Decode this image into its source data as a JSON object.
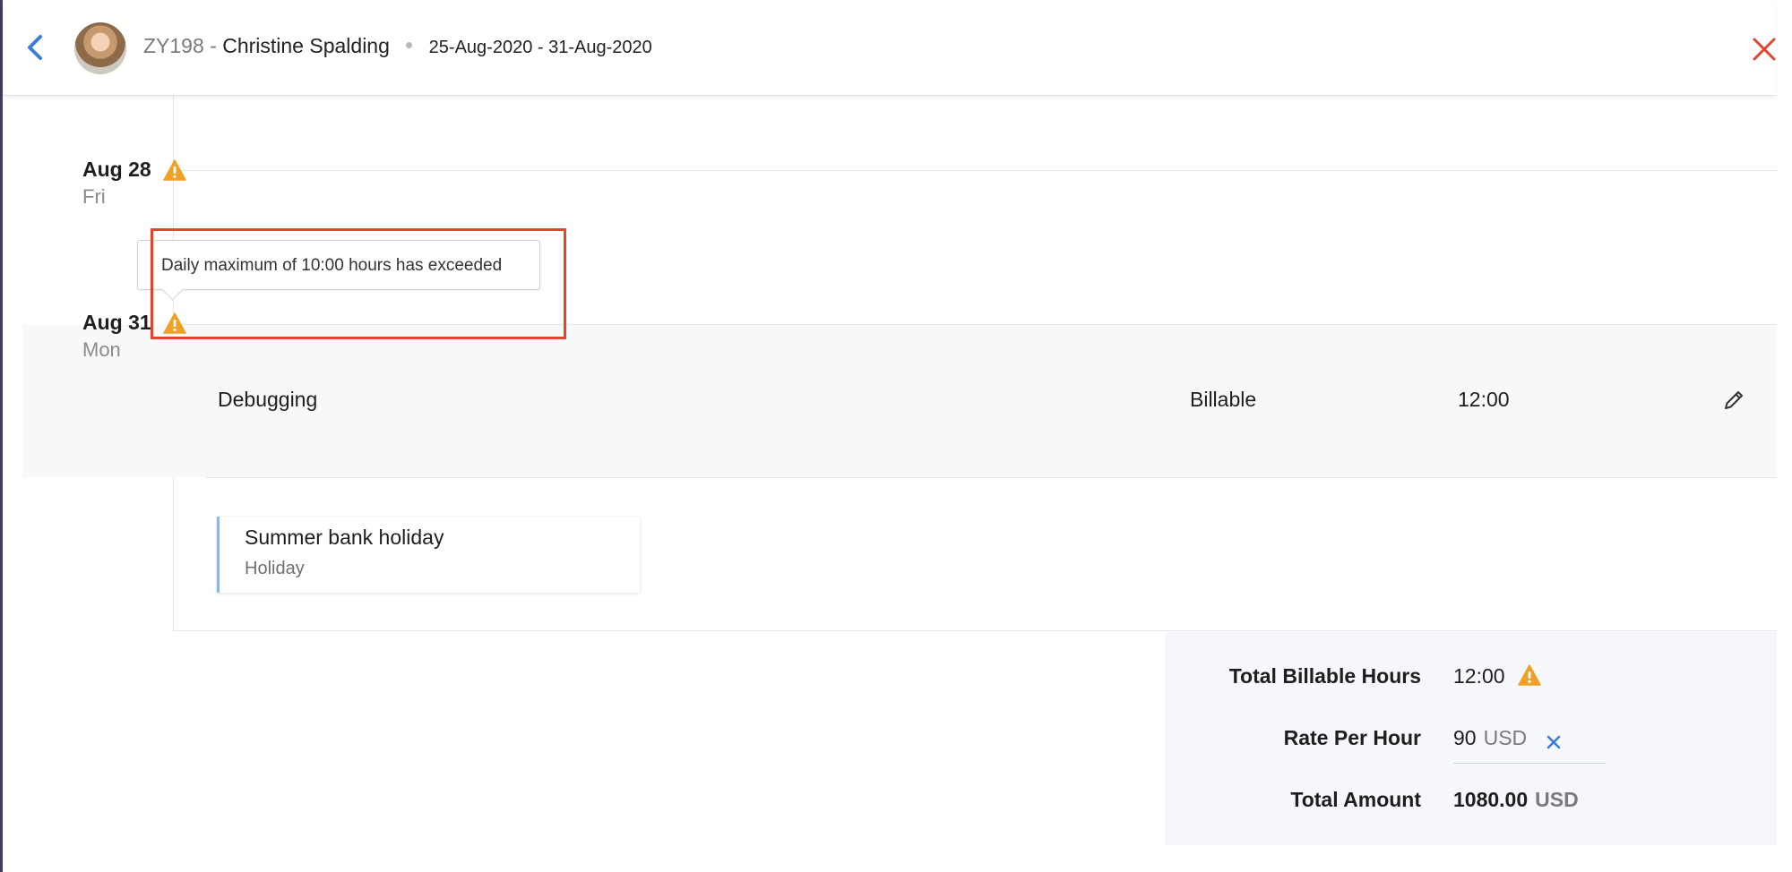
{
  "header": {
    "employee_code": "ZY198",
    "separator": "-",
    "employee_name": "Christine Spalding",
    "date_range": "25-Aug-2020 - 31-Aug-2020"
  },
  "days": [
    {
      "date": "Aug 28",
      "weekday": "Fri",
      "warning": true
    },
    {
      "date": "Aug 31",
      "weekday": "Mon",
      "warning": true
    }
  ],
  "tooltip": {
    "message": "Daily maximum of 10:00 hours has exceeded"
  },
  "entry": {
    "task": "Debugging",
    "billing_type": "Billable",
    "hours": "12:00"
  },
  "holiday": {
    "title": "Summer bank holiday",
    "type": "Holiday"
  },
  "summary": {
    "total_billable_label": "Total Billable Hours",
    "total_billable_value": "12:00",
    "rate_label": "Rate Per Hour",
    "rate_value": "90",
    "rate_currency": "USD",
    "total_amount_label": "Total Amount",
    "total_amount_value": "1080.00",
    "total_amount_currency": "USD"
  },
  "colors": {
    "accent_blue": "#3b7ddd",
    "warning_orange": "#f0a024",
    "close_red": "#e0452e",
    "highlight_red": "#e0452e"
  },
  "icons": {
    "back": "chevron-left-icon",
    "close": "close-icon",
    "warning": "warning-triangle-icon",
    "edit": "pencil-icon",
    "clear": "x-icon"
  }
}
